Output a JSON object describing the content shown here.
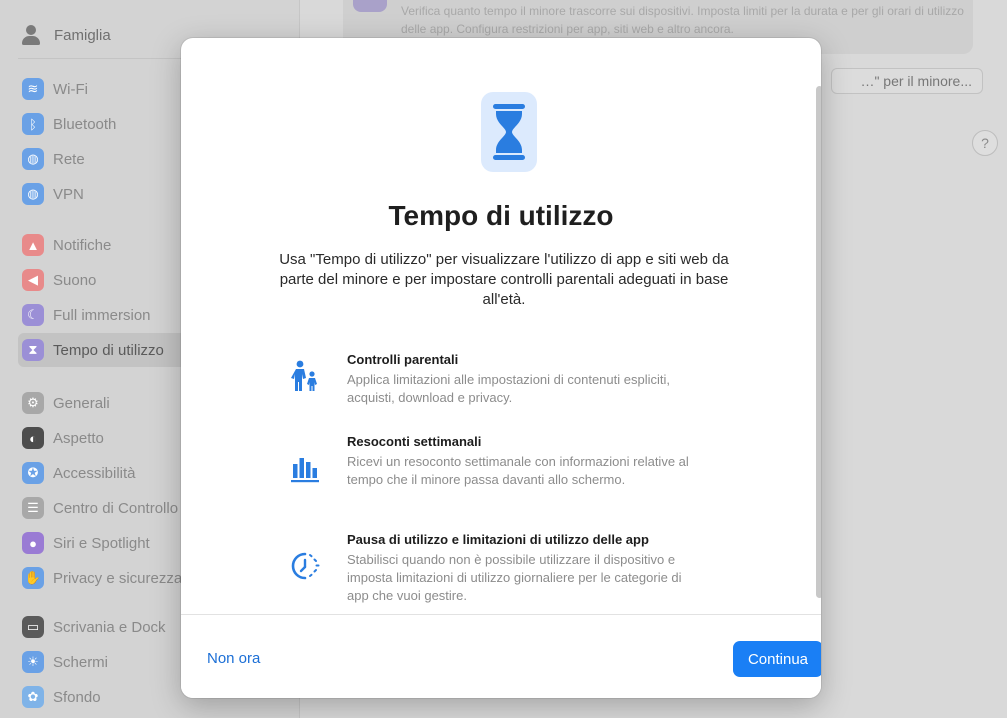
{
  "sidebar": {
    "family_label": "Famiglia",
    "groups": [
      [
        {
          "label": "Wi-Fi",
          "icon": "wifi-icon",
          "color": "#6aa1e6",
          "glyph": "≋"
        },
        {
          "label": "Bluetooth",
          "icon": "bluetooth-icon",
          "color": "#6aa1e6",
          "glyph": "ᛒ"
        },
        {
          "label": "Rete",
          "icon": "globe-icon",
          "color": "#6aa1e6",
          "glyph": "◍"
        },
        {
          "label": "VPN",
          "icon": "vpn-globe-icon",
          "color": "#6aa1e6",
          "glyph": "◍"
        }
      ],
      [
        {
          "label": "Notifiche",
          "icon": "bell-icon",
          "color": "#e88a8a",
          "glyph": "▲"
        },
        {
          "label": "Suono",
          "icon": "speaker-icon",
          "color": "#e88a8a",
          "glyph": "◀"
        },
        {
          "label": "Full immersion",
          "icon": "moon-icon",
          "color": "#9b8fd6",
          "glyph": "☾"
        },
        {
          "label": "Tempo di utilizzo",
          "icon": "hourglass-icon",
          "color": "#9b8fd6",
          "glyph": "⧗",
          "selected": true
        }
      ],
      [
        {
          "label": "Generali",
          "icon": "gear-icon",
          "color": "#a8a8a8",
          "glyph": "⚙"
        },
        {
          "label": "Aspetto",
          "icon": "appearance-icon",
          "color": "#4d4d4d",
          "glyph": "◐"
        },
        {
          "label": "Accessibilità",
          "icon": "accessibility-icon",
          "color": "#6aa1e6",
          "glyph": "✪"
        },
        {
          "label": "Centro di Controllo",
          "icon": "control-center-icon",
          "color": "#a8a8a8",
          "glyph": "☰"
        },
        {
          "label": "Siri e Spotlight",
          "icon": "siri-icon",
          "color": "#9a7bd4",
          "glyph": "●"
        },
        {
          "label": "Privacy e sicurezza",
          "icon": "hand-icon",
          "color": "#6aa1e6",
          "glyph": "✋"
        }
      ],
      [
        {
          "label": "Scrivania e Dock",
          "icon": "dock-icon",
          "color": "#5a5a5a",
          "glyph": "▭"
        },
        {
          "label": "Schermi",
          "icon": "sun-icon",
          "color": "#6aa1e6",
          "glyph": "☀"
        },
        {
          "label": "Sfondo",
          "icon": "wallpaper-icon",
          "color": "#7fb3e8",
          "glyph": "✿"
        }
      ]
    ]
  },
  "main": {
    "description": "Verifica quanto tempo il minore trascorre sui dispositivi. Imposta limiti per la durata e per gli orari di utilizzo delle app. Configura restrizioni per app, siti web e altro ancora.",
    "button_label": "…\" per il minore...",
    "help_label": "?"
  },
  "sheet": {
    "title": "Tempo di utilizzo",
    "intro": "Usa \"Tempo di utilizzo\" per visualizzare l'utilizzo di app e siti web da parte del minore e per impostare controlli parentali adeguati in base all'età.",
    "features": [
      {
        "title": "Controlli parentali",
        "description": "Applica limitazioni alle impostazioni di contenuti espliciti, acquisti, download e privacy.",
        "icon": "parent-child-icon"
      },
      {
        "title": "Resoconti settimanali",
        "description": "Ricevi un resoconto settimanale con informazioni relative al tempo che il minore passa davanti allo schermo.",
        "icon": "bar-chart-icon"
      },
      {
        "title": "Pausa di utilizzo e limitazioni di utilizzo delle app",
        "description": "Stabilisci quando non è possibile utilizzare il dispositivo e imposta limitazioni di utilizzo giornaliere per le categorie di app che vuoi gestire.",
        "icon": "downtime-icon"
      }
    ],
    "not_now_label": "Non ora",
    "continue_label": "Continua",
    "accent_color": "#1a7ff5",
    "icon_color": "#2a7de0"
  }
}
